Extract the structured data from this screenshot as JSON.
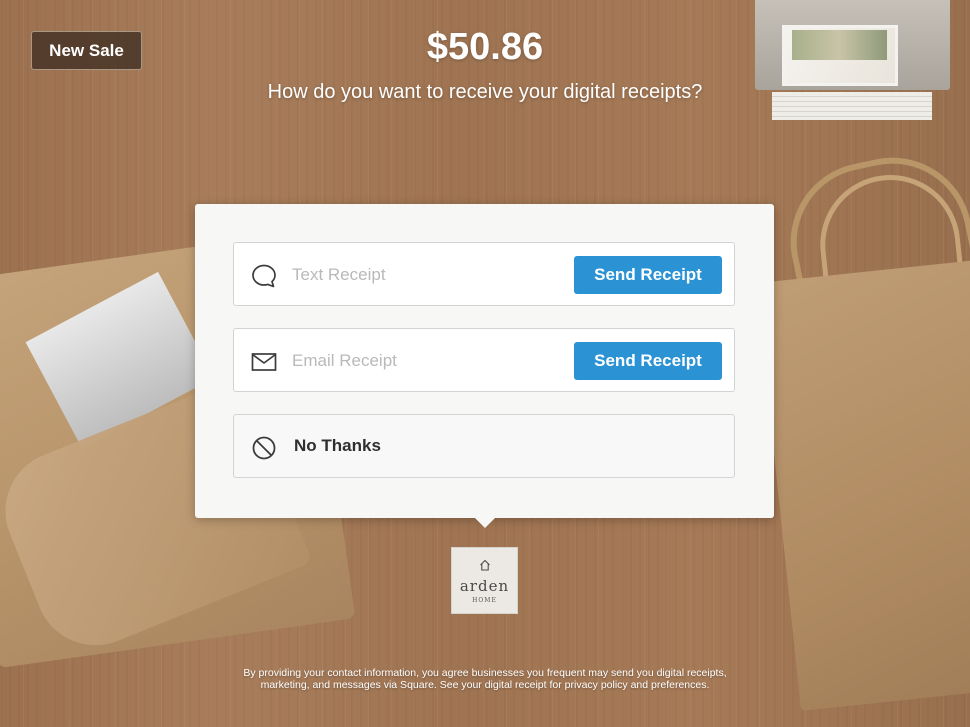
{
  "header": {
    "new_sale_label": "New Sale",
    "amount": "$50.86",
    "prompt": "How do you want to receive your digital receipts?"
  },
  "receipt_options": {
    "text": {
      "placeholder": "Text Receipt",
      "icon": "speech-bubble-icon",
      "button_label": "Send Receipt"
    },
    "email": {
      "placeholder": "Email Receipt",
      "icon": "envelope-icon",
      "button_label": "Send Receipt"
    },
    "decline": {
      "label": "No Thanks",
      "icon": "no-symbol-icon"
    }
  },
  "merchant_logo": {
    "name": "arden",
    "subtitle": "HOME",
    "icon": "house-icon"
  },
  "footer": {
    "line1": "By providing your contact information, you agree businesses you frequent may send you digital receipts,",
    "line2": "marketing, and messages via Square. See your digital receipt for privacy policy and preferences."
  },
  "colors": {
    "accent_button": "#2b93d4",
    "card_background": "#f7f7f6",
    "new_sale_background": "#463426"
  }
}
